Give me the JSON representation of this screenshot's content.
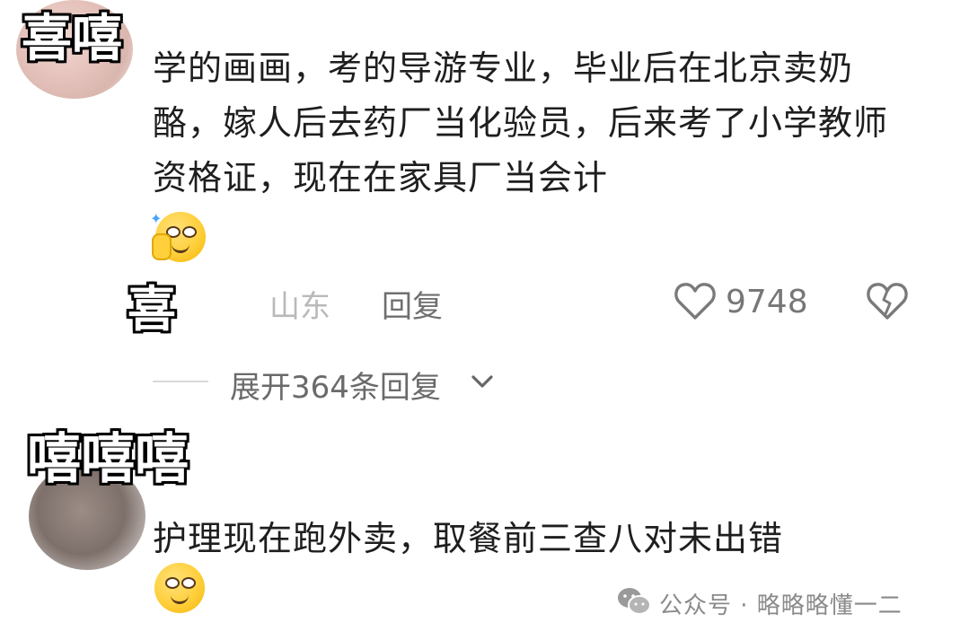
{
  "comment1": {
    "avatar_censor": "喜嘻",
    "text": "学的画画，考的导游专业，毕业后在北京卖奶酪，嫁人后去药厂当化验员，后来考了小学教师资格证，现在在家具厂当会计",
    "emoji": "smirk-thumb-emoji",
    "location": "山东",
    "reply_label": "回复",
    "like_count": "9748",
    "expand_label": "展开364条回复"
  },
  "reply_user_censor": "喜",
  "comment2": {
    "avatar_censor": "嘻嘻嘻",
    "text": "护理现在跑外卖，取餐前三查八对未出错",
    "emoji": "smile-emoji"
  },
  "watermark": {
    "text": "公众号 · 略略略懂一二"
  },
  "colors": {
    "text": "#1e1e1e",
    "meta_gray": "#6f6f6f",
    "light_gray": "#b9b9b9"
  }
}
